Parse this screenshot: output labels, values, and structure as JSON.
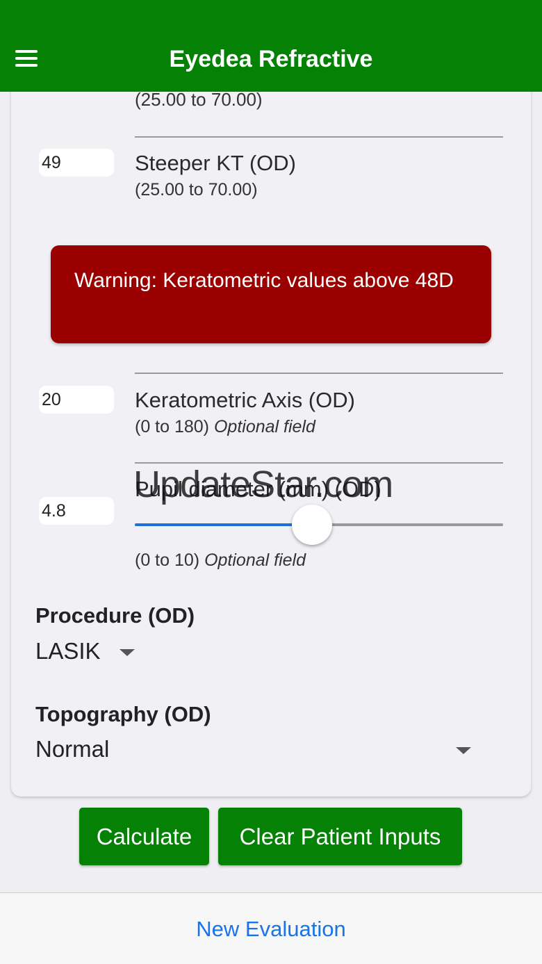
{
  "app_bar": {
    "title": "Eyedea Refractive",
    "menu_icon": "hamburger-menu-icon",
    "background_color": "#058105"
  },
  "fields": {
    "flatter_kf": {
      "range_text": "(25.00 to 70.00)"
    },
    "steeper_kt": {
      "value": "49",
      "label": "Steeper KT (OD)",
      "range_text": "(25.00 to 70.00)"
    },
    "warning": {
      "text": "Warning: Keratometric values above 48D",
      "color": "#9b0000"
    },
    "keratometric_axis": {
      "value": "20",
      "label": "Keratometric Axis (OD)",
      "range_text": "(0 to 180)",
      "optional_text": "Optional field"
    },
    "pupil_diameter": {
      "value": "4.8",
      "label": "Pupil diameter (mm) (OD)",
      "range_text": "(0 to 10)",
      "optional_text": "Optional field",
      "slider_level": 0.48
    }
  },
  "procedure": {
    "title": "Procedure (OD)",
    "selected": "LASIK"
  },
  "topography": {
    "title": "Topography (OD)",
    "selected": "Normal"
  },
  "buttons": {
    "calculate": "Calculate",
    "clear": "Clear Patient Inputs"
  },
  "bottom_bar": {
    "new_evaluation": "New Evaluation",
    "link_color": "#1a73e8"
  },
  "watermark": "UpdateStar.com"
}
